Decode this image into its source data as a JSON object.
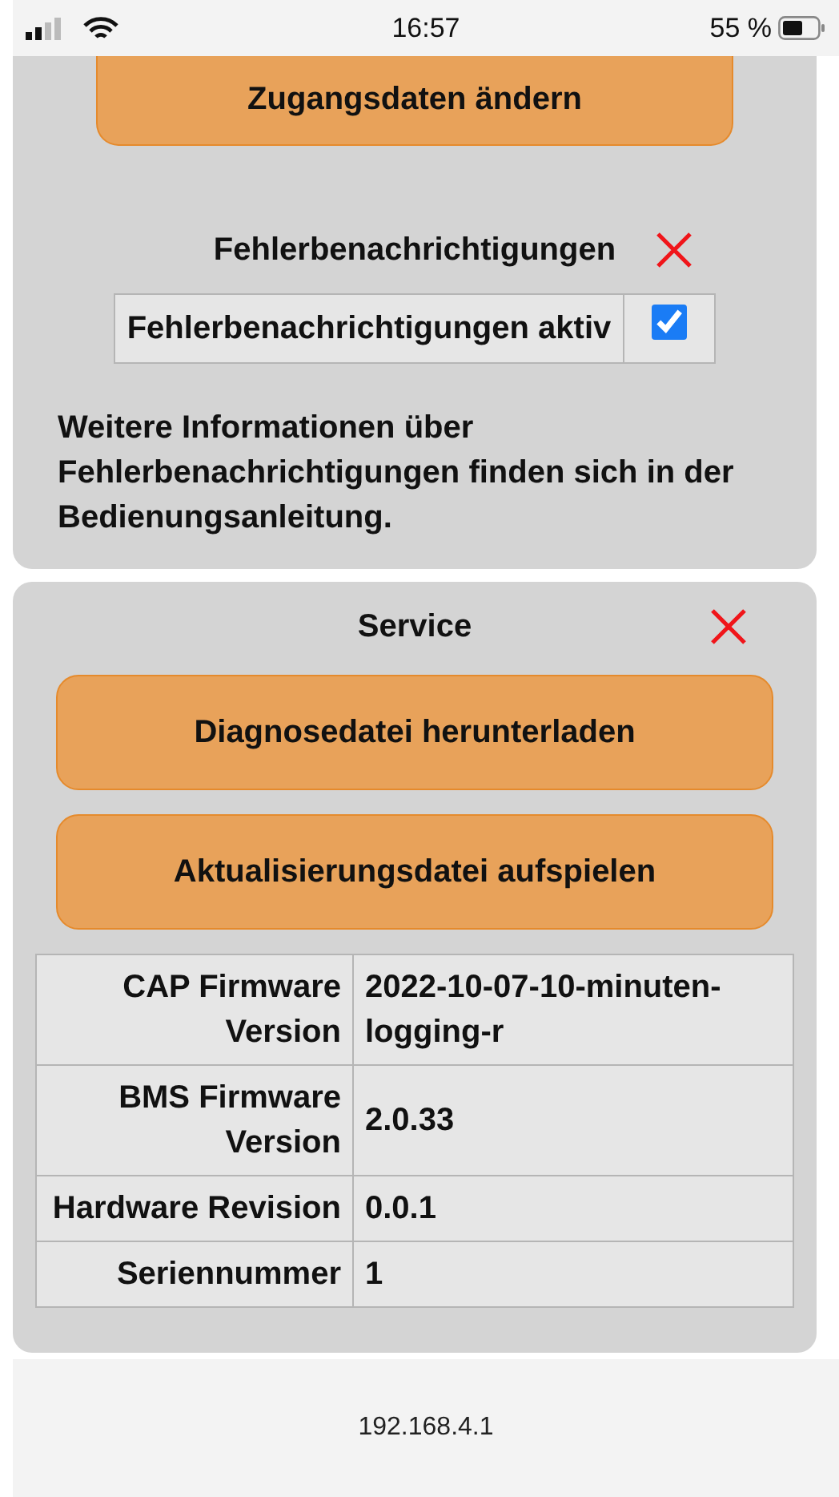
{
  "status_bar": {
    "time": "16:57",
    "battery": "55 %"
  },
  "access_button": "Zugangsdaten ändern",
  "notifications": {
    "title": "Fehlerbenachrichtigungen",
    "option": {
      "label": "Fehlerbenachrichtigungen aktiv",
      "checked": true
    },
    "info": "Weitere Informationen über Fehlerbenachrichtigungen finden sich in der Bedienungsanleitung."
  },
  "service": {
    "title": "Service",
    "buttons": [
      "Diagnosedatei herunterladen",
      "Aktualisierungsdatei aufspielen"
    ],
    "rows": [
      {
        "label": "CAP Firmware Version",
        "value": "2022-10-07-10-minuten-logging-r"
      },
      {
        "label": "BMS Firmware Version",
        "value": "2.0.33"
      },
      {
        "label": "Hardware Revision",
        "value": "0.0.1"
      },
      {
        "label": "Seriennummer",
        "value": "1"
      }
    ]
  },
  "address": "192.168.4.1"
}
